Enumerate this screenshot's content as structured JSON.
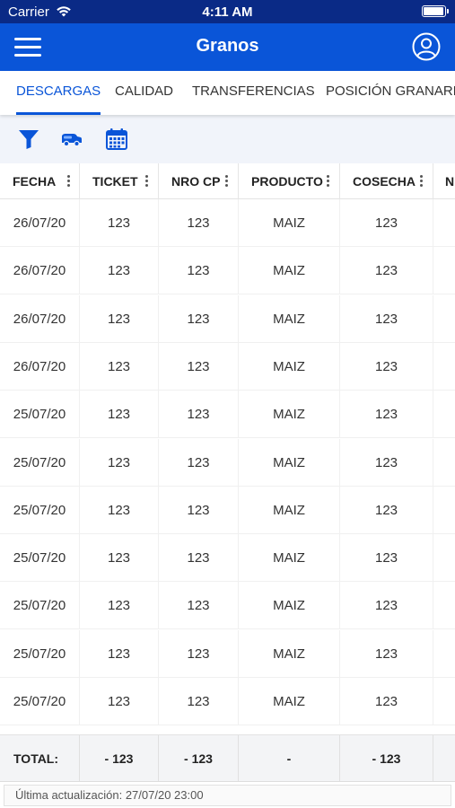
{
  "status_bar": {
    "carrier": "Carrier",
    "time": "4:11 AM"
  },
  "header": {
    "title": "Granos"
  },
  "tabs": [
    {
      "label": "DESCARGAS",
      "active": true
    },
    {
      "label": "CALIDAD",
      "active": false
    },
    {
      "label": "TRANSFERENCIAS",
      "active": false
    },
    {
      "label": "POSICIÓN GRANARIA",
      "active": false
    }
  ],
  "toolbar": {
    "icons": [
      "filter-icon",
      "truck-icon",
      "calendar-icon"
    ]
  },
  "colors": {
    "status_bar": "#0a2a86",
    "header": "#0a55d8",
    "accent": "#0a55d8",
    "toolbar_bg": "#f1f4fa"
  },
  "table": {
    "columns": [
      "FECHA",
      "TICKET",
      "NRO CP",
      "PRODUCTO",
      "COSECHA",
      "N"
    ],
    "rows": [
      [
        "26/07/20",
        "123",
        "123",
        "MAIZ",
        "123"
      ],
      [
        "26/07/20",
        "123",
        "123",
        "MAIZ",
        "123"
      ],
      [
        "26/07/20",
        "123",
        "123",
        "MAIZ",
        "123"
      ],
      [
        "26/07/20",
        "123",
        "123",
        "MAIZ",
        "123"
      ],
      [
        "25/07/20",
        "123",
        "123",
        "MAIZ",
        "123"
      ],
      [
        "25/07/20",
        "123",
        "123",
        "MAIZ",
        "123"
      ],
      [
        "25/07/20",
        "123",
        "123",
        "MAIZ",
        "123"
      ],
      [
        "25/07/20",
        "123",
        "123",
        "MAIZ",
        "123"
      ],
      [
        "25/07/20",
        "123",
        "123",
        "MAIZ",
        "123"
      ],
      [
        "25/07/20",
        "123",
        "123",
        "MAIZ",
        "123"
      ],
      [
        "25/07/20",
        "123",
        "123",
        "MAIZ",
        "123"
      ]
    ],
    "totals": [
      "TOTAL:",
      "- 123",
      "- 123",
      "-",
      "- 123"
    ]
  },
  "footer": {
    "last_update": "Última actualización: 27/07/20 23:00"
  }
}
